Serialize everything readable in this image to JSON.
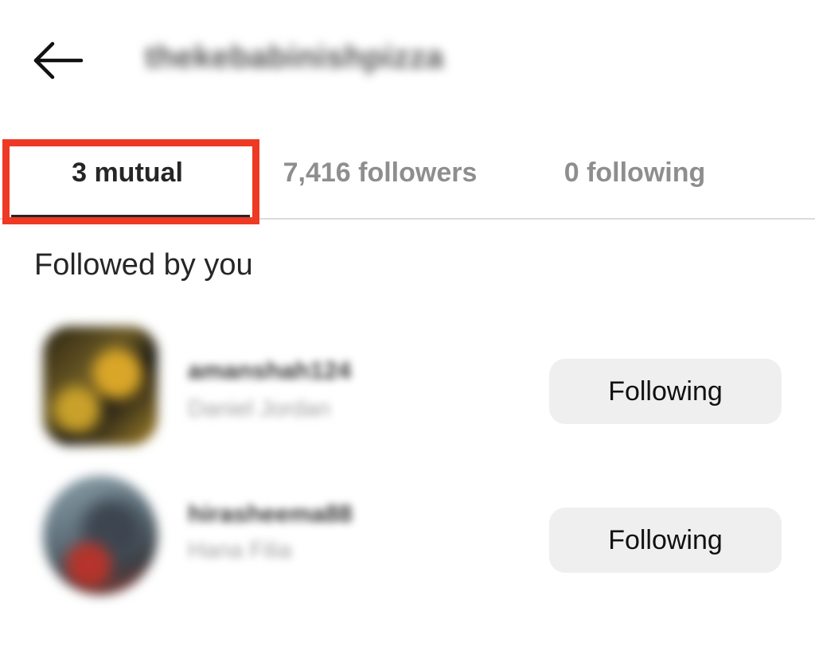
{
  "header": {
    "back_icon": "arrow-left-icon",
    "title": "thekebabinishpizza"
  },
  "tabs": [
    {
      "label": "3 mutual",
      "active": true
    },
    {
      "label": "7,416 followers",
      "active": false
    },
    {
      "label": "0 following",
      "active": false
    }
  ],
  "highlight": {
    "color": "#ee3a24"
  },
  "section": {
    "title": "Followed by you"
  },
  "users": [
    {
      "username": "amanshah124",
      "full_name": "Daniel Jordan",
      "button_label": "Following"
    },
    {
      "username": "hirasheema88",
      "full_name": "Hana Filia",
      "button_label": "Following"
    }
  ]
}
